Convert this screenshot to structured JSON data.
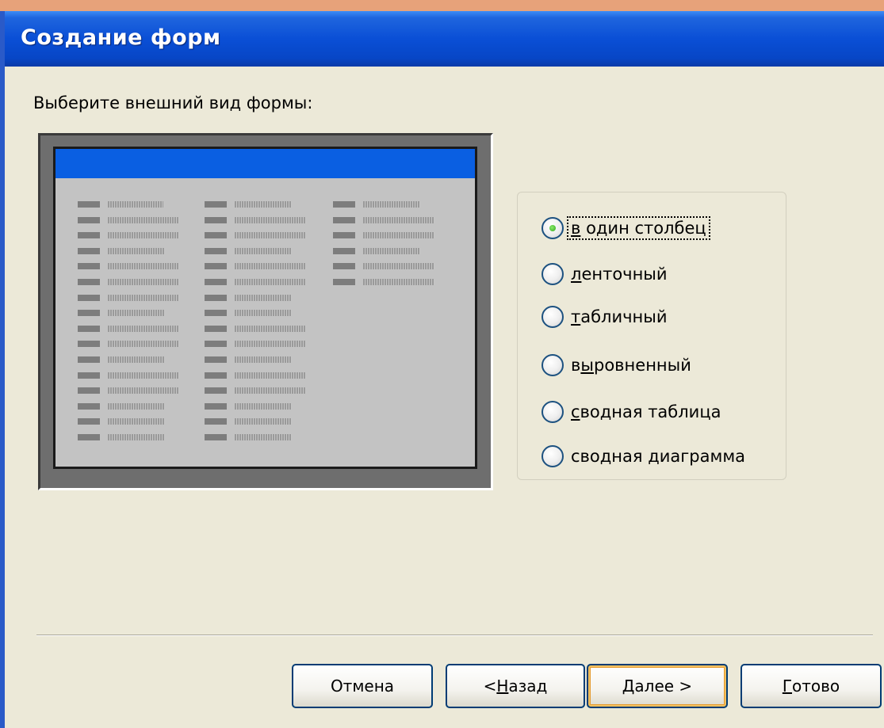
{
  "window": {
    "title": "Создание форм"
  },
  "prompt": "Выберите внешний вид формы:",
  "layout_options": [
    {
      "pre": "",
      "key": "в",
      "post": " один столбец",
      "checked": true
    },
    {
      "pre": "",
      "key": "л",
      "post": "енточный",
      "checked": false
    },
    {
      "pre": "",
      "key": "т",
      "post": "абличный",
      "checked": false
    },
    {
      "pre": "в",
      "key": "ы",
      "post": "ровненный",
      "checked": false
    },
    {
      "pre": "",
      "key": "с",
      "post": "водная таблица",
      "checked": false
    },
    {
      "pre": "сводная ",
      "key": "д",
      "post": "иаграмма",
      "checked": false
    }
  ],
  "buttons": {
    "cancel": {
      "pre": "Отмена",
      "key": "",
      "post": ""
    },
    "back": {
      "pre": "< ",
      "key": "Н",
      "post": "азад"
    },
    "next": {
      "pre": "",
      "key": "Д",
      "post": "алее >"
    },
    "finish": {
      "pre": "",
      "key": "Г",
      "post": "отово"
    }
  },
  "colors": {
    "titlebar": "#0a4fd6",
    "preview_header": "#0a5fe2",
    "dialog_background": "#ece9d8"
  }
}
